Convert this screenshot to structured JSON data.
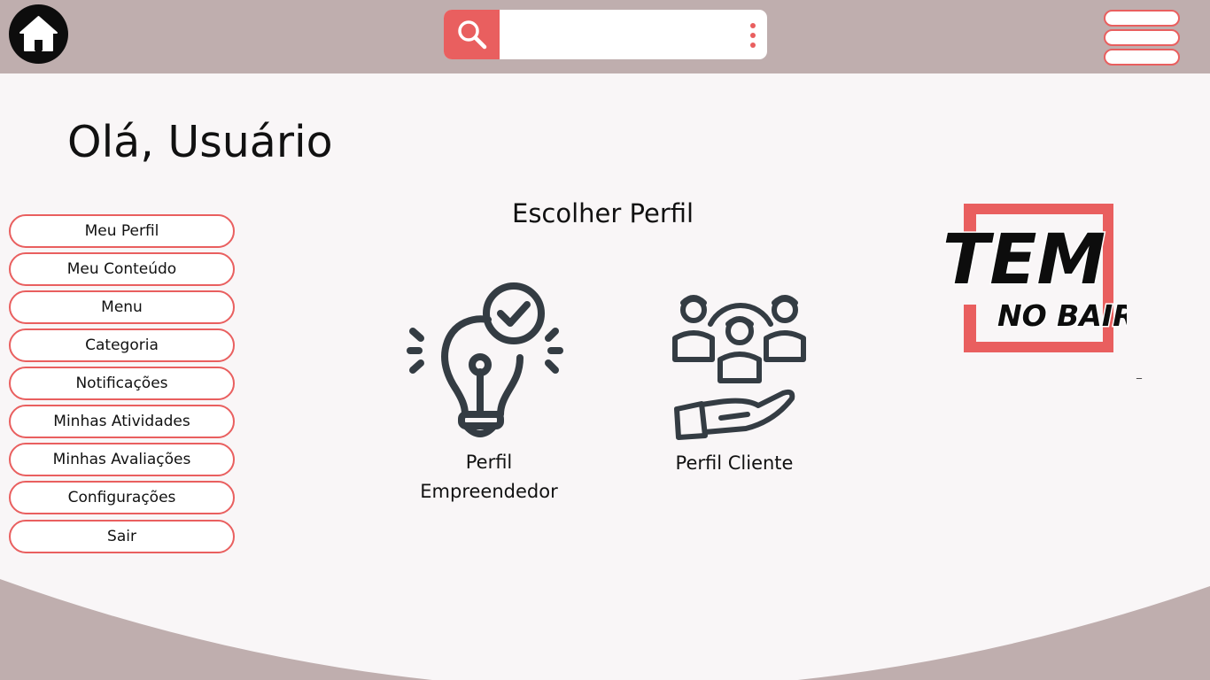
{
  "header": {
    "home_icon": "home-icon",
    "search": {
      "icon": "search-icon",
      "value": "",
      "placeholder": "",
      "more_icon": "more-vertical-icon"
    },
    "menu_icon": "hamburger-menu-icon"
  },
  "greeting": "Olá, Usuário",
  "sidebar": {
    "items": [
      {
        "label": "Meu Perfil"
      },
      {
        "label": "Meu Conteúdo"
      },
      {
        "label": "Menu"
      },
      {
        "label": "Categoria"
      },
      {
        "label": "Notificações"
      },
      {
        "label": "Minhas Atividades"
      },
      {
        "label": "Minhas Avaliações"
      },
      {
        "label": "Configurações"
      },
      {
        "label": "Sair"
      }
    ]
  },
  "main": {
    "title": "Escolher Perfil",
    "profiles": [
      {
        "line1": "Perfil",
        "line2": "Empreendedor",
        "icon": "lightbulb-check-icon"
      },
      {
        "label": "Perfil  Cliente",
        "icon": "clients-hand-icon"
      }
    ]
  },
  "logo": {
    "line1": "TEM",
    "line2": "NO BAIRRO"
  },
  "small_mark": "_",
  "colors": {
    "header_bg": "#bfaeae",
    "accent": "#e95f5f",
    "page_bg": "#f9f6f7",
    "icon_dark": "#343c43"
  }
}
